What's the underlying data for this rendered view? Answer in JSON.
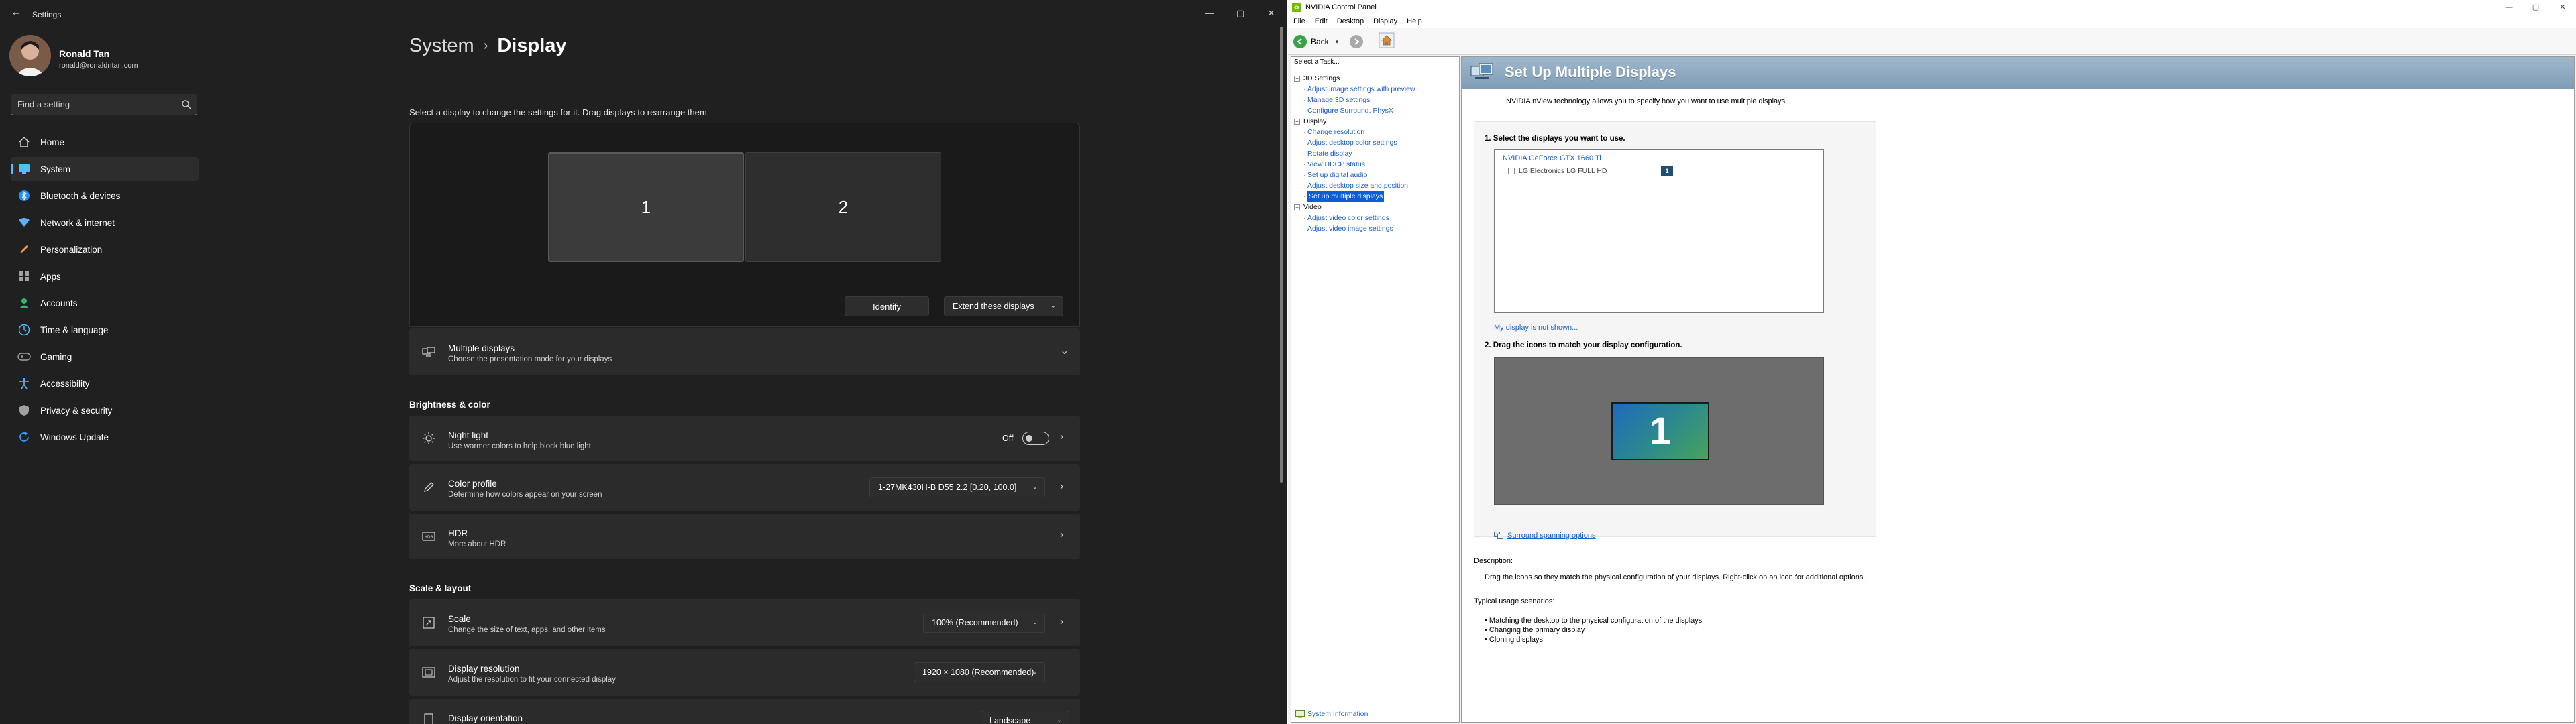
{
  "settings": {
    "app_title": "Settings",
    "profile": {
      "name": "Ronald Tan",
      "email": "ronald@ronaldntan.com"
    },
    "search": {
      "placeholder": "Find a setting"
    },
    "nav": [
      {
        "label": "Home",
        "icon": "home-icon",
        "color": "#d9d9d9"
      },
      {
        "label": "System",
        "icon": "monitor-icon",
        "color": "#4cc2ff",
        "active": true
      },
      {
        "label": "Bluetooth & devices",
        "icon": "bluetooth-icon",
        "color": "#1e90ff"
      },
      {
        "label": "Network & internet",
        "icon": "wifi-icon",
        "color": "#5fb0ff"
      },
      {
        "label": "Personalization",
        "icon": "brush-icon",
        "color": "#e8a04c"
      },
      {
        "label": "Apps",
        "icon": "apps-icon",
        "color": "#a0a0a0"
      },
      {
        "label": "Accounts",
        "icon": "person-icon",
        "color": "#2fb86b"
      },
      {
        "label": "Time & language",
        "icon": "globe-clock-icon",
        "color": "#4cc2ff"
      },
      {
        "label": "Gaming",
        "icon": "gamepad-icon",
        "color": "#a0a0a0"
      },
      {
        "label": "Accessibility",
        "icon": "accessibility-icon",
        "color": "#5fb0ff"
      },
      {
        "label": "Privacy & security",
        "icon": "shield-icon",
        "color": "#a0a0a0"
      },
      {
        "label": "Windows Update",
        "icon": "update-icon",
        "color": "#2f9bff"
      }
    ],
    "breadcrumb": {
      "parent": "System",
      "separator": "›",
      "current": "Display"
    },
    "hint": "Select a display to change the settings for it. Drag displays to rearrange them.",
    "monitors": [
      "1",
      "2"
    ],
    "identify_label": "Identify",
    "extend_label": "Extend these displays",
    "multiple_displays": {
      "title": "Multiple displays",
      "subtitle": "Choose the presentation mode for your displays"
    },
    "brightness_header": "Brightness & color",
    "night_light": {
      "title": "Night light",
      "subtitle": "Use warmer colors to help block blue light",
      "state": "Off"
    },
    "color_profile": {
      "title": "Color profile",
      "subtitle": "Determine how colors appear on your screen",
      "value": "1-27MK430H-B D55 2.2 [0.20, 100.0]"
    },
    "hdr": {
      "title": "HDR",
      "subtitle": "More about HDR"
    },
    "scale_header": "Scale & layout",
    "scale": {
      "title": "Scale",
      "subtitle": "Change the size of text, apps, and other items",
      "value": "100% (Recommended)"
    },
    "resolution": {
      "title": "Display resolution",
      "subtitle": "Adjust the resolution to fit your connected display",
      "value": "1920 × 1080 (Recommended)"
    },
    "orientation": {
      "title": "Display orientation",
      "value": "Landscape"
    },
    "accent_color": "#4cc2ff"
  },
  "nvidia": {
    "title": "NVIDIA Control Panel",
    "menu": [
      "File",
      "Edit",
      "Desktop",
      "Display",
      "Help"
    ],
    "back_label": "Back",
    "select_task": "Select a Task...",
    "tree": [
      {
        "level": 0,
        "label": "3D Settings",
        "type": "group"
      },
      {
        "level": 1,
        "label": "Adjust image settings with preview",
        "type": "link"
      },
      {
        "level": 1,
        "label": "Manage 3D settings",
        "type": "link"
      },
      {
        "level": 1,
        "label": "Configure Surround, PhysX",
        "type": "link"
      },
      {
        "level": 0,
        "label": "Display",
        "type": "group"
      },
      {
        "level": 1,
        "label": "Change resolution",
        "type": "link"
      },
      {
        "level": 1,
        "label": "Adjust desktop color settings",
        "type": "link"
      },
      {
        "level": 1,
        "label": "Rotate display",
        "type": "link"
      },
      {
        "level": 1,
        "label": "View HDCP status",
        "type": "link"
      },
      {
        "level": 1,
        "label": "Set up digital audio",
        "type": "link"
      },
      {
        "level": 1,
        "label": "Adjust desktop size and position",
        "type": "link"
      },
      {
        "level": 1,
        "label": "Set up multiple displays",
        "type": "link",
        "selected": true
      },
      {
        "level": 0,
        "label": "Video",
        "type": "group"
      },
      {
        "level": 1,
        "label": "Adjust video color settings",
        "type": "link"
      },
      {
        "level": 1,
        "label": "Adjust video image settings",
        "type": "link"
      }
    ],
    "system_info": "System Information",
    "page_title": "Set Up Multiple Displays",
    "intro": "NVIDIA nView technology allows you to specify how you want to use multiple displays",
    "step1": "1. Select the displays you want to use.",
    "gpu": "NVIDIA GeForce GTX 1660 Ti",
    "display_name": "LG Electronics LG FULL HD",
    "display_number": "1",
    "not_shown_link": "My display is not shown...",
    "step2": "2. Drag the icons to match your display configuration.",
    "arrange_monitor_number": "1",
    "surround_link": "Surround spanning options",
    "description_label": "Description:",
    "description_text": "Drag the icons so they match the physical configuration of your displays. Right-click on an icon for additional options.",
    "usage_label": "Typical usage scenarios:",
    "usage": [
      "Matching the desktop to the physical configuration of the displays",
      "Changing the primary display",
      "Cloning displays"
    ],
    "banner_color": "#8fa9c0",
    "link_color": "#1a5ecc"
  }
}
